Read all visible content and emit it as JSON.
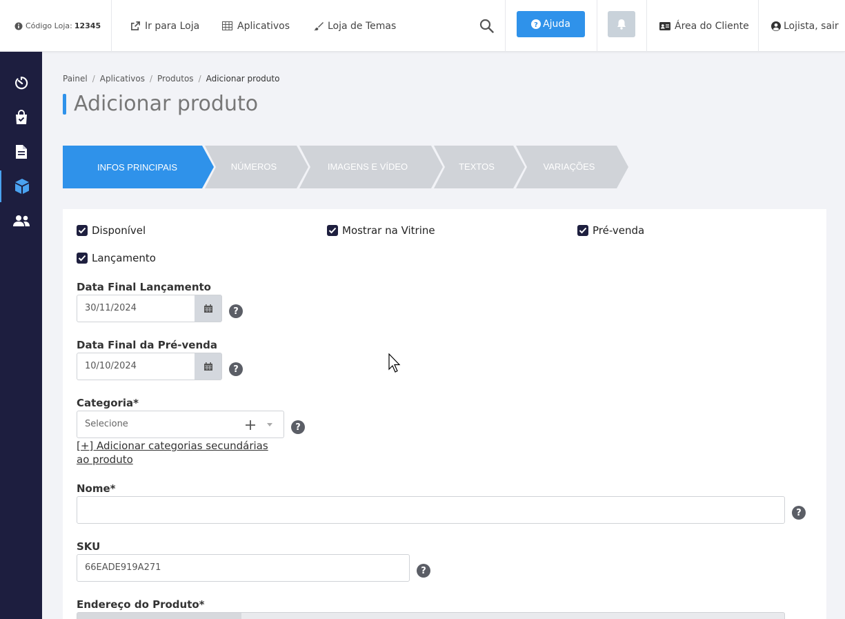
{
  "topbar": {
    "store_code_label": "Código Loja:",
    "store_code_value": "12345",
    "go_to_store": "Ir para Loja",
    "apps": "Aplicativos",
    "themes": "Loja de Temas",
    "help": "Ajuda",
    "client_area": "Área do Cliente",
    "user": "Lojista, sair"
  },
  "sidebar": {
    "items": [
      {
        "icon": "dashboard-icon"
      },
      {
        "icon": "shopping-bag-icon"
      },
      {
        "icon": "document-icon"
      },
      {
        "icon": "box-icon",
        "active": true
      },
      {
        "icon": "users-icon"
      }
    ]
  },
  "breadcrumb": [
    "Painel",
    "Aplicativos",
    "Produtos",
    "Adicionar produto"
  ],
  "page_title": "Adicionar produto",
  "steps": [
    {
      "label": "INFOS PRINCIPAIS",
      "active": true
    },
    {
      "label": "NÚMEROS",
      "active": false
    },
    {
      "label": "IMAGENS E VÍDEO",
      "active": false
    },
    {
      "label": "TEXTOS",
      "active": false
    },
    {
      "label": "VARIAÇÕES",
      "active": false
    }
  ],
  "form": {
    "checks": {
      "available": "Disponível",
      "showcase": "Mostrar na Vitrine",
      "presale": "Pré-venda",
      "launch": "Lançamento"
    },
    "launch_end": {
      "label": "Data Final Lançamento",
      "value": "30/11/2024"
    },
    "presale_end": {
      "label": "Data Final da Pré-venda",
      "value": "10/10/2024"
    },
    "category": {
      "label": "Categoria*",
      "placeholder": "Selecione",
      "add_secondary_line1": "[+] Adicionar categorias secundárias",
      "add_secondary_line2": "ao produto"
    },
    "name": {
      "label": "Nome*",
      "value": ""
    },
    "sku": {
      "label": "SKU",
      "value": "66EADE919A271"
    },
    "address": {
      "label": "Endereço do Produto*"
    }
  },
  "colors": {
    "accent": "#2f92ea",
    "sidebar": "#1d1e3f",
    "step_inactive": "#d0d3d8"
  }
}
